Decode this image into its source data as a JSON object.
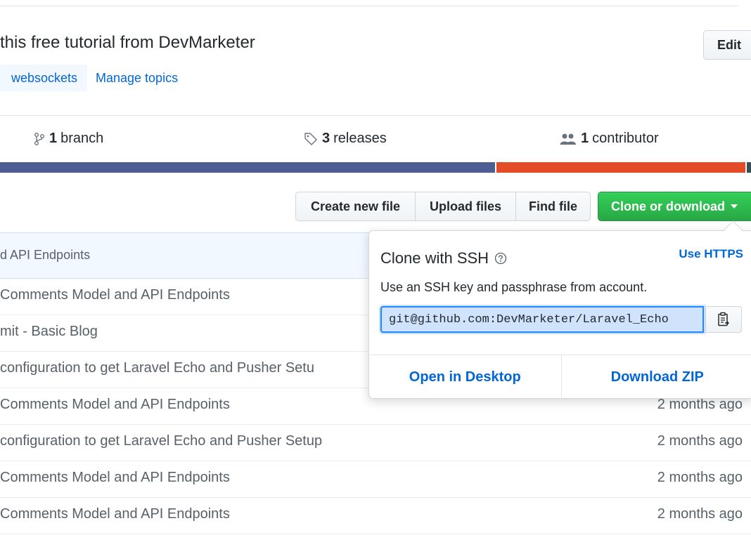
{
  "repo": {
    "description": "this free tutorial from DevMarketer",
    "edit_label": "Edit",
    "topics": [
      "websockets"
    ],
    "manage_topics_label": "Manage topics"
  },
  "numbers": {
    "branch": {
      "count": "1",
      "label": "branch"
    },
    "releases": {
      "count": "3",
      "label": "releases"
    },
    "contributors": {
      "count": "1",
      "label": "contributor"
    }
  },
  "language_bar": [
    {
      "color": "#4f5d95",
      "percent": 66.1
    },
    {
      "color": "#e34c26",
      "percent": 33.3
    },
    {
      "color": "#384d54",
      "percent": 0.6
    }
  ],
  "file_nav": {
    "create_new_file": "Create new file",
    "upload_files": "Upload files",
    "find_file": "Find file",
    "clone_or_download": "Clone or download"
  },
  "latest_commit": {
    "message": "d API Endpoints"
  },
  "files": [
    {
      "message": "Comments Model and API Endpoints",
      "age": ""
    },
    {
      "message": "mit - Basic Blog",
      "age": ""
    },
    {
      "message": "configuration to get Laravel Echo and Pusher Setu",
      "age": ""
    },
    {
      "message": "Comments Model and API Endpoints",
      "age": "2 months ago"
    },
    {
      "message": "configuration to get Laravel Echo and Pusher Setup",
      "age": "2 months ago"
    },
    {
      "message": "Comments Model and API Endpoints",
      "age": "2 months ago"
    },
    {
      "message": "Comments Model and API Endpoints",
      "age": "2 months ago"
    }
  ],
  "clone_popover": {
    "title": "Clone with SSH",
    "use_https_label": "Use HTTPS",
    "description": "Use an SSH key and passphrase from account.",
    "url": "git@github.com:DevMarketer/Laravel_Echo",
    "open_in_desktop": "Open in Desktop",
    "download_zip": "Download ZIP"
  }
}
